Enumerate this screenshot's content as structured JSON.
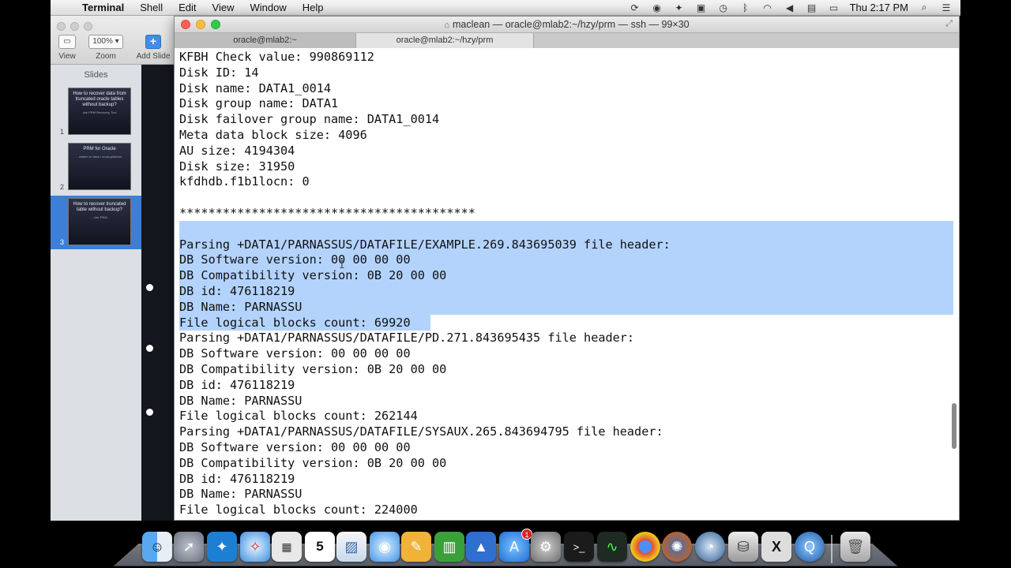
{
  "menubar": {
    "app_name": "Terminal",
    "menus": [
      "Shell",
      "Edit",
      "View",
      "Window",
      "Help"
    ],
    "clock": "Thu 2:17 PM"
  },
  "keynote": {
    "toolbar": {
      "view_label": "View",
      "zoom_label": "Zoom",
      "zoom_value": "100%",
      "add_slide_label": "Add Slide"
    },
    "slides_title": "Slides",
    "slides": [
      {
        "num": "1",
        "title": "How to recover data from truncated oracle tables without backup?",
        "subtitle": "use PRM Recovery Tool"
      },
      {
        "num": "2",
        "title": "PRM for Oracle",
        "subtitle": "- written in Java • cross-platform"
      },
      {
        "num": "3",
        "title": "How to recover truncated table without backup?",
        "subtitle": "- Use PRM"
      }
    ]
  },
  "terminal": {
    "title": "maclean — oracle@mlab2:~/hzy/prm — ssh — 99×30",
    "tabs": [
      "oracle@mlab2:~",
      "oracle@mlab2:~/hzy/prm"
    ],
    "lines": [
      "KFBH Check value: 990869112",
      "Disk ID: 14",
      "Disk name: DATA1_0014",
      "Disk group name: DATA1",
      "Disk failover group name: DATA1_0014",
      "Meta data block size: 4096",
      "AU size: 4194304",
      "Disk size: 31950",
      "kfdhdb.f1b1locn: 0",
      "",
      "*****************************************",
      "",
      "Parsing +DATA1/PARNASSUS/DATAFILE/EXAMPLE.269.843695039 file header:",
      "DB Software version: 00 00 00 00",
      "DB Compatibility version: 0B 20 00 00",
      "DB id: 476118219",
      "DB Name: PARNASSU",
      "File logical blocks count: 69920",
      "Parsing +DATA1/PARNASSUS/DATAFILE/PD.271.843695435 file header:",
      "DB Software version: 00 00 00 00",
      "DB Compatibility version: 0B 20 00 00",
      "DB id: 476118219",
      "DB Name: PARNASSU",
      "File logical blocks count: 262144",
      "Parsing +DATA1/PARNASSUS/DATAFILE/SYSAUX.265.843694795 file header:",
      "DB Software version: 00 00 00 00",
      "DB Compatibility version: 0B 20 00 00",
      "DB id: 476118219",
      "DB Name: PARNASSU",
      "File logical blocks count: 224000"
    ],
    "selection_color": "#b3d3fd"
  },
  "dock": {
    "calendar_day": "5",
    "app_store_badge": "1",
    "apps": [
      "finder-icon",
      "launchpad-icon",
      "tweetbot-icon",
      "safari-icon",
      "calculator-icon",
      "calendar-icon",
      "preview-icon",
      "messages-icon",
      "pages-icon",
      "numbers-icon",
      "keynote-icon",
      "app-store-icon",
      "system-preferences-icon",
      "terminal-icon",
      "activity-monitor-icon",
      "chrome-icon",
      "firefox-icon",
      "navicat-icon",
      "database-icon",
      "x11-icon",
      "quicktime-icon",
      "trash-icon"
    ]
  }
}
